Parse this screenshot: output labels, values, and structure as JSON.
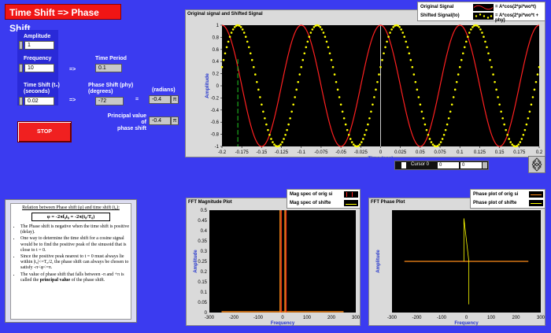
{
  "app_title": "Time Shift => Phase Shift",
  "controls": {
    "amplitude_label": "Amplitude",
    "amplitude_value": "1",
    "frequency_label": "Frequency",
    "frequency_value": "10",
    "time_shift_label_line1": "Time Shift (t₀)",
    "time_shift_label_line2": "(seconds)",
    "time_shift_value": "0.02",
    "arrow1": "=>",
    "arrow2": "=>",
    "time_period_label": "Time Period",
    "time_period_value": "0.1",
    "phase_shift_label_line1": "Phase Shift (phy)",
    "phase_shift_label_line2": "(degrees)",
    "phase_shift_value": "-72",
    "equals": "=",
    "radians_label": "(radians)",
    "radians_value": "-0.4",
    "pi_symbol": "π",
    "principal_label_line1": "Principal value of",
    "principal_label_line2": "phase shift",
    "principal_value": "-0.4",
    "stop_label": "STOP"
  },
  "main_plot": {
    "title": "Original signal and Shifted Signal",
    "legend": [
      {
        "name": "Original Signal",
        "formula": "= A*cos(2*pi*wo*t)",
        "color": "#ff2020"
      },
      {
        "name": "Shifted Signal(to)",
        "formula": "= A*cos(2*pi*wo*t + phy)",
        "color": "#ffff00"
      }
    ],
    "xlabel": "Time (sec)",
    "ylabel": "Amplitude",
    "xlim": [
      -0.2,
      0.2
    ],
    "ylim": [
      -1,
      1
    ],
    "xticks": [
      "-0.2",
      "-0.175",
      "-0.15",
      "-0.125",
      "-0.1",
      "-0.075",
      "-0.05",
      "-0.025",
      "0",
      "0.025",
      "0.05",
      "0.075",
      "0.1",
      "0.125",
      "0.15",
      "0.175",
      "0.2"
    ],
    "yticks": [
      "1",
      "0.8",
      "0.6",
      "0.4",
      "0.2",
      "0",
      "-0.2",
      "-0.4",
      "-0.6",
      "-0.8",
      "-1"
    ],
    "cursor_name": "Cursor 0",
    "cursor_x": "0",
    "cursor_y": "0",
    "cursor_marker_x": -0.18
  },
  "fft_mag_plot": {
    "title": "FFT Magnitude Plot",
    "legend": [
      "Mag spec of orig si",
      "Mag spec of shifte"
    ],
    "xlabel": "Frequency",
    "ylabel": "Amplitude",
    "xticks": [
      "-300",
      "-200",
      "-100",
      "0",
      "100",
      "200",
      "300"
    ],
    "yticks": [
      "0.5",
      "0.45",
      "0.4",
      "0.35",
      "0.3",
      "0.25",
      "0.2",
      "0.15",
      "0.1",
      "0.05",
      "0"
    ]
  },
  "fft_phase_plot": {
    "title": "FFT Phase Plot",
    "legend": [
      "Phase plot of orig si",
      "Phase plot of shifte"
    ],
    "xlabel": "Frequency",
    "ylabel": "Amplitude",
    "xticks": [
      "-300",
      "-200",
      "-100",
      "0",
      "100",
      "200",
      "300"
    ]
  },
  "note": {
    "heading": "Relation between Phase shift (φ) and time shift (t₀):",
    "formula": "φ = -2πf₀t₀ = -2π(t₀/T₀)",
    "bullets": [
      "The Phase shift is negative when the time shift is positive (delay).",
      "One way to determine the time shift for a cosine signal would be to find the positive peak of the sinusoid that is close to t = 0.",
      "Since the positive peak nearest to t = 0 must always lie within |t₀|<=T₀/2, the phase shift can always be chosen to satisfy -π<φ<=π.",
      "The value of phase shift that falls between -π and +π is called the"
    ],
    "bullet4_bold": "principal value",
    "bullet4_tail": "of the phase shift."
  },
  "chart_data": [
    {
      "type": "line",
      "title": "Original signal and Shifted Signal",
      "xlabel": "Time (sec)",
      "ylabel": "Amplitude",
      "xlim": [
        -0.2,
        0.2
      ],
      "ylim": [
        -1,
        1
      ],
      "series": [
        {
          "name": "Original Signal",
          "function": "1*cos(2*pi*10*t)",
          "amplitude": 1,
          "frequency": 10,
          "phase_rad": 0
        },
        {
          "name": "Shifted Signal(to)",
          "function": "1*cos(2*pi*10*t - 0.4*pi)",
          "amplitude": 1,
          "frequency": 10,
          "phase_rad": -1.2566
        }
      ]
    },
    {
      "type": "bar",
      "title": "FFT Magnitude Plot",
      "xlabel": "Frequency",
      "ylabel": "Amplitude",
      "xlim": [
        -300,
        300
      ],
      "ylim": [
        0,
        0.5
      ],
      "series": [
        {
          "name": "Mag spec of orig si",
          "x": [
            -10,
            10
          ],
          "values": [
            0.5,
            0.5
          ]
        },
        {
          "name": "Mag spec of shifte",
          "x": [
            -10,
            10
          ],
          "values": [
            0.5,
            0.5
          ]
        }
      ]
    },
    {
      "type": "line",
      "title": "FFT Phase Plot",
      "xlabel": "Frequency",
      "ylabel": "Amplitude",
      "xlim": [
        -300,
        300
      ],
      "ylim": [
        -1.5,
        1.5
      ],
      "series": [
        {
          "name": "Phase plot of orig si",
          "x": [
            -250,
            250
          ],
          "values": [
            0,
            0
          ]
        },
        {
          "name": "Phase plot of shifte",
          "x": [
            -10,
            -10,
            10,
            10
          ],
          "values": [
            0,
            1.26,
            0,
            -1.26
          ]
        }
      ]
    }
  ]
}
